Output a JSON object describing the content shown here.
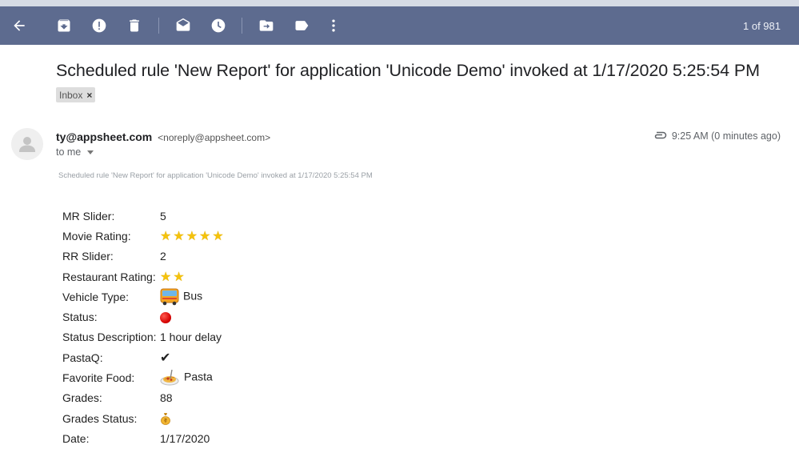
{
  "toolbar": {
    "counter": "1 of 981",
    "icons": [
      "back-arrow-icon",
      "archive-icon",
      "report-spam-icon",
      "delete-icon",
      "mark-unread-icon",
      "snooze-icon",
      "move-to-icon",
      "label-icon",
      "more-vert-icon"
    ]
  },
  "email": {
    "subject": "Scheduled rule 'New Report' for application 'Unicode Demo' invoked at 1/17/2020 5:25:54 PM",
    "label": "Inbox",
    "label_remove": "×",
    "sender_name": "ty@appsheet.com",
    "sender_email": "<noreply@appsheet.com>",
    "to": "to me",
    "time": "9:25 AM (0 minutes ago)",
    "preheader": "Scheduled rule 'New Report' for application 'Unicode Demo' invoked at 1/17/2020 5:25:54 PM"
  },
  "fields": {
    "mr_slider": {
      "label": "MR Slider:",
      "value": "5"
    },
    "movie_rating": {
      "label": "Movie Rating:",
      "value": "★★★★★",
      "stars": 5
    },
    "rr_slider": {
      "label": "RR Slider:",
      "value": "2"
    },
    "restaurant_rating": {
      "label": "Restaurant Rating:",
      "value": "★★",
      "stars": 2
    },
    "vehicle_type": {
      "label": "Vehicle Type:",
      "value": "Bus",
      "icon": "bus-icon"
    },
    "status": {
      "label": "Status:",
      "icon": "red-circle-icon",
      "color": "#d50000"
    },
    "status_description": {
      "label": "Status Description:",
      "value": "1 hour delay"
    },
    "pastaq": {
      "label": "PastaQ:",
      "value": "✔"
    },
    "favorite_food": {
      "label": "Favorite Food:",
      "value": "Pasta",
      "icon": "spaghetti-icon"
    },
    "grades": {
      "label": "Grades:",
      "value": "88"
    },
    "grades_status": {
      "label": "Grades Status:",
      "icon": "money-bag-icon"
    },
    "date": {
      "label": "Date:",
      "value": "1/17/2020"
    }
  },
  "colors": {
    "toolbar_bg": "#5d6b8f",
    "star": "#f4c20d",
    "status_red": "#d50000"
  }
}
